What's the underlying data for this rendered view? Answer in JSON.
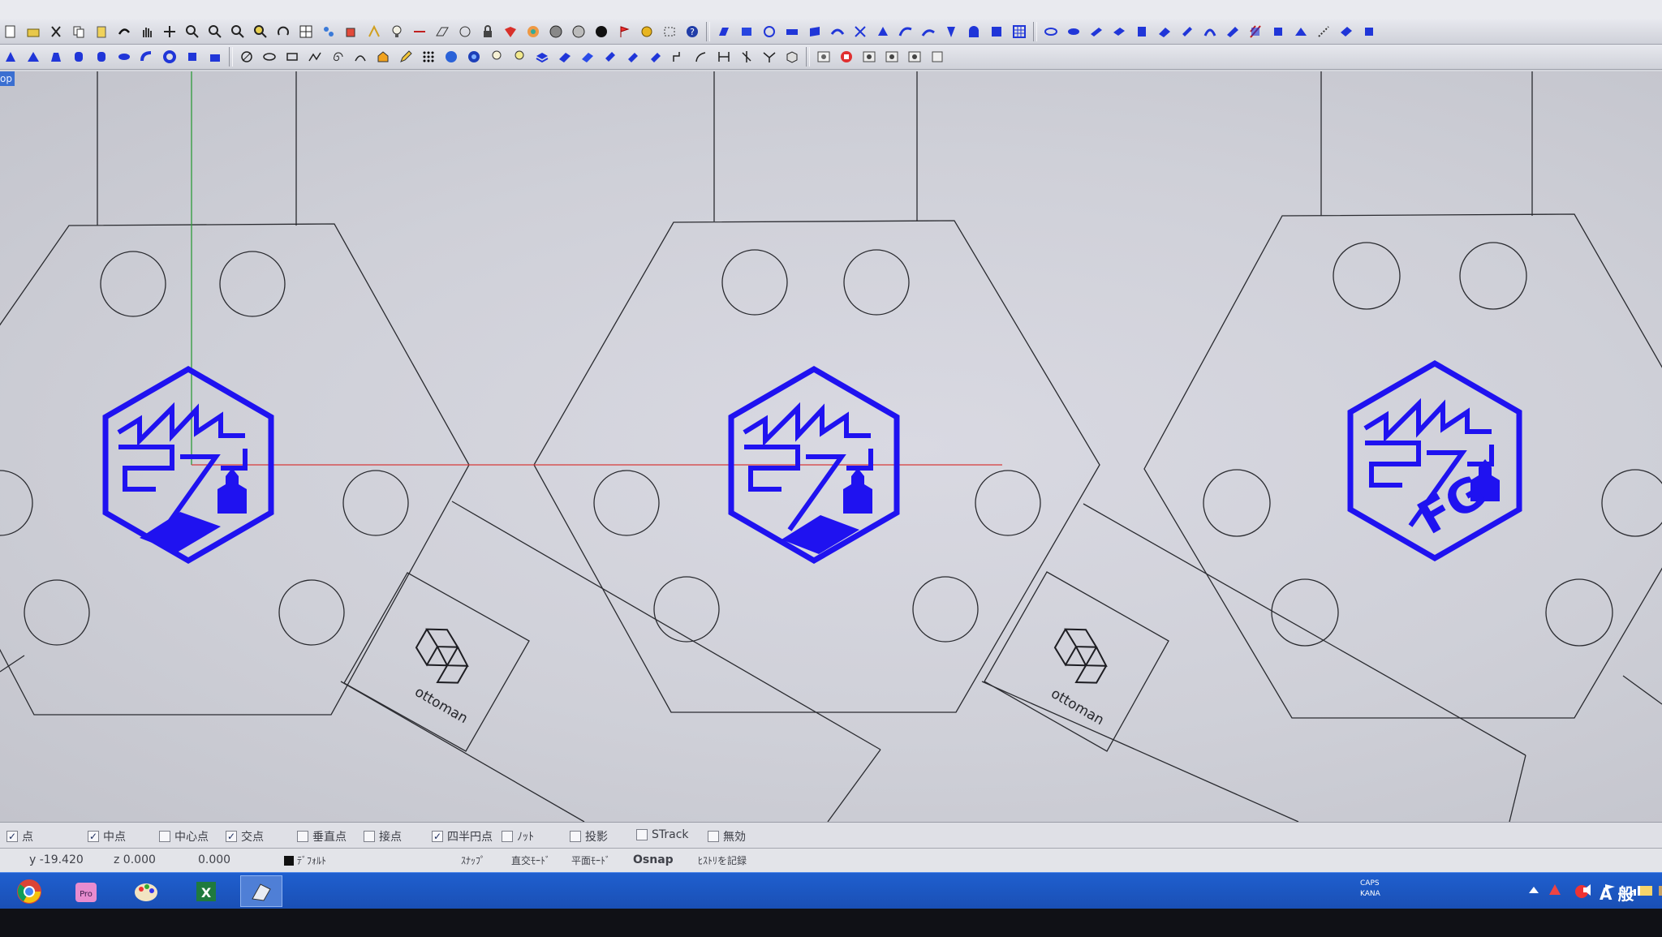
{
  "viewport": {
    "label": "op",
    "logos": [
      {
        "index": 1,
        "bottom_text": ""
      },
      {
        "index": 2,
        "bottom_text": ""
      },
      {
        "index": 3,
        "bottom_text": "FG"
      }
    ],
    "plates": [
      {
        "brand": "ottoman"
      },
      {
        "brand": "ottoman"
      }
    ]
  },
  "osnap": [
    {
      "label": "点",
      "checked": "✓"
    },
    {
      "label": "中点",
      "checked": "✓"
    },
    {
      "label": "中心点",
      "checked": ""
    },
    {
      "label": "交点",
      "checked": "✓"
    },
    {
      "label": "垂直点",
      "checked": ""
    },
    {
      "label": "接点",
      "checked": ""
    },
    {
      "label": "四半円点",
      "checked": "✓"
    },
    {
      "label": "ﾉｯﾄ",
      "checked": ""
    },
    {
      "label": "投影",
      "checked": ""
    },
    {
      "label": "STrack",
      "checked": ""
    },
    {
      "label": "無効",
      "checked": ""
    }
  ],
  "status": {
    "y": "y -19.420",
    "z": "z 0.000",
    "value": "0.000",
    "layer": "ﾃﾞﾌｫﾙﾄ",
    "snap": "ｽﾅｯﾌﾟ",
    "ortho": "直交ﾓｰﾄﾞ",
    "planar": "平面ﾓｰﾄﾞ",
    "osnap": "Osnap",
    "history": "ﾋｽﾄﾘを記録"
  },
  "tray": {
    "ime": "A 般",
    "caps": "CAPS",
    "kana": "KANA"
  },
  "colors": {
    "logo_blue": "#1f12f0",
    "axis_red": "#d63a3a",
    "axis_green": "#2e9b3a",
    "taskbar": "#1d56c4"
  }
}
